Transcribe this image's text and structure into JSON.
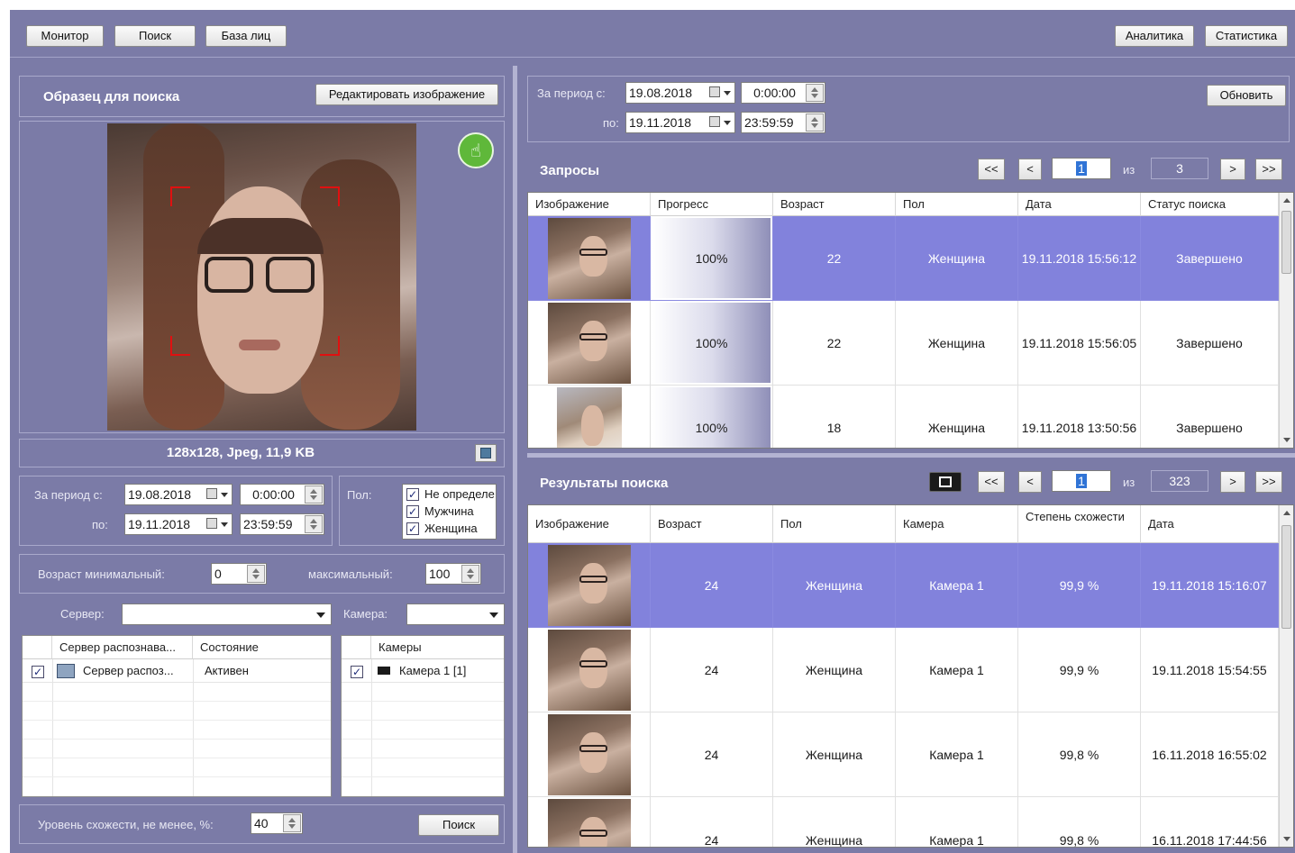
{
  "top_nav": {
    "monitor": "Монитор",
    "search": "Поиск",
    "faces": "База лиц",
    "analytics": "Аналитика",
    "statistics": "Статистика"
  },
  "sample": {
    "title": "Образец для поиска",
    "edit_button": "Редактировать изображение",
    "info": "128x128, Jpeg, 11,9 KB"
  },
  "left_period": {
    "from_label": "За период с:",
    "from_date": "19.08.2018",
    "from_time": "0:00:00",
    "to_label": "по:",
    "to_date": "19.11.2018",
    "to_time": "23:59:59"
  },
  "gender": {
    "label": "Пол:",
    "options": [
      {
        "label": "Не определе",
        "checked": true
      },
      {
        "label": "Мужчина",
        "checked": true
      },
      {
        "label": "Женщина",
        "checked": true
      }
    ]
  },
  "age": {
    "min_label": "Возраст минимальный:",
    "min_value": "0",
    "max_label": "максимальный:",
    "max_value": "100"
  },
  "server": {
    "label": "Сервер:",
    "value": ""
  },
  "camera": {
    "label": "Камера:",
    "value": ""
  },
  "server_table": {
    "headers": [
      "Сервер распознава...",
      "Состояние"
    ],
    "rows": [
      {
        "name": "Сервер распоз...",
        "state": "Активен",
        "checked": true
      }
    ]
  },
  "camera_table": {
    "header": "Камеры",
    "rows": [
      {
        "name": "Камера 1 [1]",
        "checked": true
      }
    ]
  },
  "similarity": {
    "label": "Уровень схожести, не менее, %:",
    "value": "40",
    "search_button": "Поиск"
  },
  "right_period": {
    "from_label": "За период с:",
    "from_date": "19.08.2018",
    "from_time": "0:00:00",
    "to_label": "по:",
    "to_date": "19.11.2018",
    "to_time": "23:59:59",
    "refresh_button": "Обновить"
  },
  "requests": {
    "title": "Запросы",
    "pager": {
      "first": "<<",
      "prev": "<",
      "page": "1",
      "of": "из",
      "total": "3",
      "next": ">",
      "last": ">>"
    },
    "headers": [
      "Изображение",
      "Прогресс",
      "Возраст",
      "Пол",
      "Дата",
      "Статус поиска"
    ],
    "rows": [
      {
        "progress": "100%",
        "age": "22",
        "gender": "Женщина",
        "date": "19.11.2018 15:56:12",
        "status": "Завершено",
        "selected": true
      },
      {
        "progress": "100%",
        "age": "22",
        "gender": "Женщина",
        "date": "19.11.2018 15:56:05",
        "status": "Завершено",
        "selected": false
      },
      {
        "progress": "100%",
        "age": "18",
        "gender": "Женщина",
        "date": "19.11.2018 13:50:56",
        "status": "Завершено",
        "selected": false
      }
    ]
  },
  "results": {
    "title": "Результаты поиска",
    "pager": {
      "first": "<<",
      "prev": "<",
      "page": "1",
      "of": "из",
      "total": "323",
      "next": ">",
      "last": ">>"
    },
    "headers": [
      "Изображение",
      "Возраст",
      "Пол",
      "Камера",
      "Степень схожести",
      "Дата"
    ],
    "rows": [
      {
        "age": "24",
        "gender": "Женщина",
        "camera": "Камера 1",
        "similarity": "99,9 %",
        "date": "19.11.2018 15:16:07",
        "selected": true
      },
      {
        "age": "24",
        "gender": "Женщина",
        "camera": "Камера 1",
        "similarity": "99,9 %",
        "date": "19.11.2018 15:54:55",
        "selected": false
      },
      {
        "age": "24",
        "gender": "Женщина",
        "camera": "Камера 1",
        "similarity": "99,8 %",
        "date": "16.11.2018 16:55:02",
        "selected": false
      },
      {
        "age": "24",
        "gender": "Женщина",
        "camera": "Камера 1",
        "similarity": "99,8 %",
        "date": "16.11.2018 17:44:56",
        "selected": false
      }
    ]
  }
}
